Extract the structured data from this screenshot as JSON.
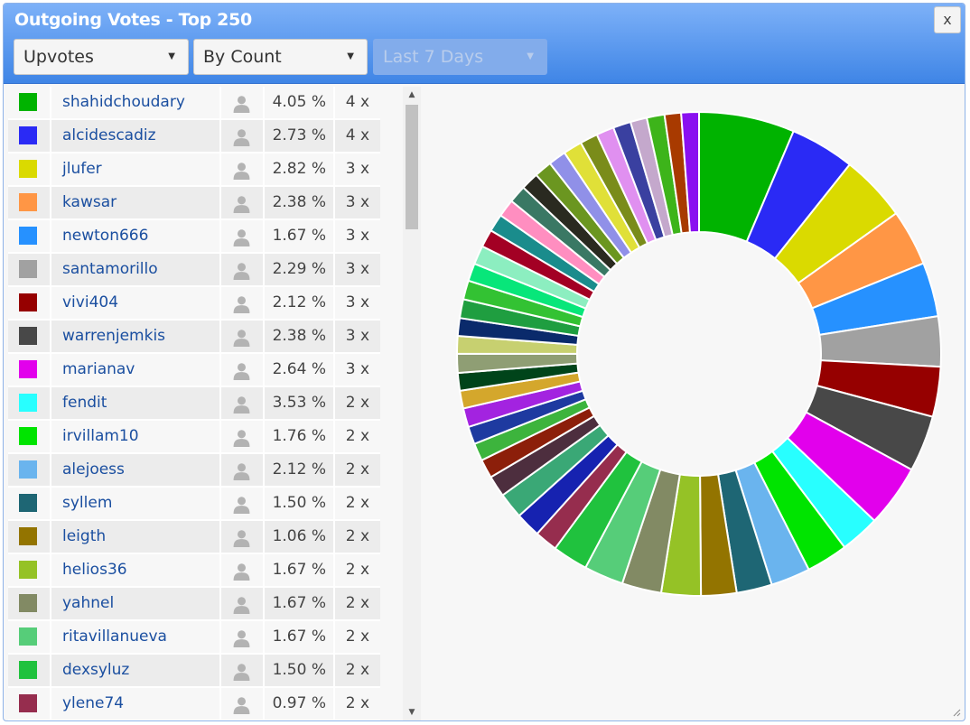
{
  "header": {
    "title": "Outgoing Votes - Top 250",
    "close_label": "x"
  },
  "filters": {
    "vote_type": "Upvotes",
    "sort": "By Count",
    "period": "Last 7 Days"
  },
  "voters": [
    {
      "name": "shahidchoudary",
      "color": "#00b300",
      "pct": "4.05 %",
      "count": "4 x"
    },
    {
      "name": "alcidescadiz",
      "color": "#2a2af5",
      "pct": "2.73 %",
      "count": "4 x"
    },
    {
      "name": "jlufer",
      "color": "#dada00",
      "pct": "2.82 %",
      "count": "3 x"
    },
    {
      "name": "kawsar",
      "color": "#ff9645",
      "pct": "2.38 %",
      "count": "3 x"
    },
    {
      "name": "newton666",
      "color": "#2691ff",
      "pct": "1.67 %",
      "count": "3 x"
    },
    {
      "name": "santamorillo",
      "color": "#a1a1a1",
      "pct": "2.29 %",
      "count": "3 x"
    },
    {
      "name": "vivi404",
      "color": "#960000",
      "pct": "2.12 %",
      "count": "3 x"
    },
    {
      "name": "warrenjemkis",
      "color": "#484848",
      "pct": "2.38 %",
      "count": "3 x"
    },
    {
      "name": "marianav",
      "color": "#e200ec",
      "pct": "2.64 %",
      "count": "3 x"
    },
    {
      "name": "fendit",
      "color": "#28ffff",
      "pct": "3.53 %",
      "count": "2 x"
    },
    {
      "name": "irvillam10",
      "color": "#00e400",
      "pct": "1.76 %",
      "count": "2 x"
    },
    {
      "name": "alejoess",
      "color": "#6ab4ee",
      "pct": "2.12 %",
      "count": "2 x"
    },
    {
      "name": "syllem",
      "color": "#1e6674",
      "pct": "1.50 %",
      "count": "2 x"
    },
    {
      "name": "leigth",
      "color": "#937400",
      "pct": "1.06 %",
      "count": "2 x"
    },
    {
      "name": "helios36",
      "color": "#95c226",
      "pct": "1.67 %",
      "count": "2 x"
    },
    {
      "name": "yahnel",
      "color": "#828a64",
      "pct": "1.67 %",
      "count": "2 x"
    },
    {
      "name": "ritavillanueva",
      "color": "#56cd79",
      "pct": "1.67 %",
      "count": "2 x"
    },
    {
      "name": "dexsyluz",
      "color": "#20c23e",
      "pct": "1.50 %",
      "count": "2 x"
    },
    {
      "name": "ylene74",
      "color": "#962d4e",
      "pct": "0.97 %",
      "count": "2 x"
    }
  ],
  "chart_data": {
    "type": "pie",
    "donut": true,
    "slice_colors": [
      "#00b300",
      "#2a2af5",
      "#dada00",
      "#ff9645",
      "#2691ff",
      "#a1a1a1",
      "#960000",
      "#484848",
      "#e200ec",
      "#28ffff",
      "#00e400",
      "#6ab4ee",
      "#1e6674",
      "#937400",
      "#95c226",
      "#828a64",
      "#56cd79",
      "#20c23e",
      "#962d4e",
      "#1622b0",
      "#3aa876",
      "#4d2e3e",
      "#8c1f0a",
      "#3db43d",
      "#1e3aa0",
      "#a323e0",
      "#d4a72c",
      "#00441a",
      "#8f9e74",
      "#c7d070",
      "#0a2a6b",
      "#1f9e40",
      "#33c233",
      "#08e67a",
      "#8ceec0",
      "#a30024",
      "#1a8c8c",
      "#ff8ec0",
      "#3a7864",
      "#2a2a20",
      "#6b9620",
      "#9090e8",
      "#e0e038",
      "#7a8c1a",
      "#e090f0",
      "#3a40a0",
      "#c4a8cc",
      "#3db41a",
      "#a83a00",
      "#8a10f0"
    ],
    "values": [
      4.05,
      2.73,
      2.82,
      2.38,
      2.29,
      2.12,
      2.12,
      2.38,
      2.64,
      1.67,
      1.76,
      1.67,
      1.5,
      1.5,
      1.67,
      1.67,
      1.67,
      1.5,
      0.97,
      1.06,
      1.1,
      0.9,
      0.8,
      0.75,
      0.75,
      0.8,
      0.75,
      0.75,
      0.8,
      0.75,
      0.75,
      0.8,
      0.8,
      0.75,
      0.8,
      0.75,
      0.75,
      0.75,
      0.75,
      0.75,
      0.75,
      0.75,
      0.8,
      0.75,
      0.75,
      0.75,
      0.7,
      0.75,
      0.7,
      0.75
    ]
  }
}
